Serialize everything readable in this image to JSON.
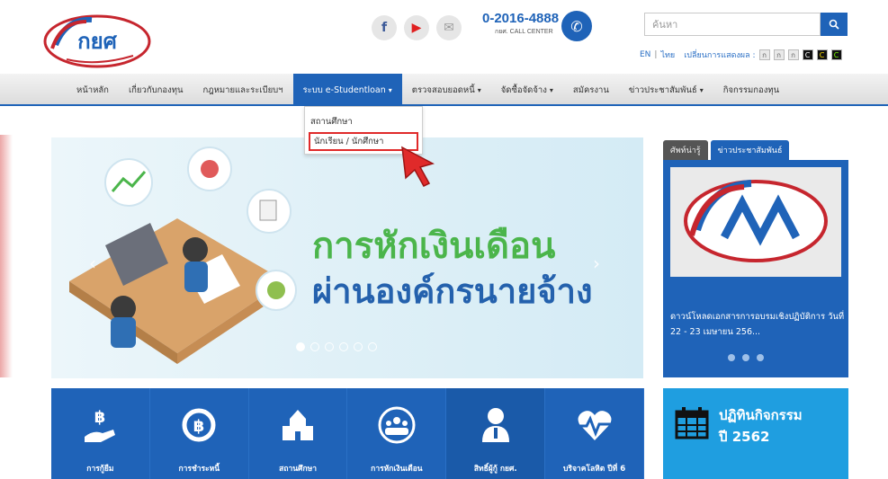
{
  "header": {
    "logo_text": "กยศ",
    "call": {
      "number": "0-2016-4888",
      "sub": "กยศ. CALL CENTER"
    },
    "search": {
      "placeholder": "ค้นหา"
    },
    "lang": {
      "en": "EN",
      "th": "ไทย"
    },
    "accessibility_label": "เปลี่ยนการแสดงผล :",
    "accessibility_options": [
      "ก",
      "ก",
      "ก",
      "C",
      "C",
      "C"
    ]
  },
  "nav": {
    "items": [
      "หน้าหลัก",
      "เกี่ยวกับกองทุน",
      "กฎหมายและระเบียบฯ",
      "ระบบ e-Studentloan",
      "ตรวจสอบยอดหนี้",
      "จัดซื้อจัดจ้าง",
      "สมัครงาน",
      "ข่าวประชาสัมพันธ์",
      "กิจกรรมกองทุน"
    ]
  },
  "dropdown": {
    "items": [
      "สถานศึกษา",
      "นักเรียน / นักศึกษา"
    ]
  },
  "banner": {
    "line1": "การหักเงินเดือน",
    "line2": "ผ่านองค์กรนายจ้าง"
  },
  "news": {
    "tab1": "ศัพท์น่ารู้",
    "tab2": "ข่าวประชาสัมพันธ์",
    "text": "ดาวน์โหลดเอกสารการอบรมเชิงปฏิบัติการ วันที่ 22 - 23 เมษายน 256..."
  },
  "tiles": [
    "การกู้ยืม",
    "การชำระหนี้",
    "สถานศึกษา",
    "การหักเงินเดือน",
    "สิทธิ์ผู้กู้ กยศ.",
    "บริจาคโลหิต ปีที่ 6"
  ],
  "activity": {
    "title": "ปฏิทินกิจกรรม",
    "year": "ปี 2562"
  },
  "colors": {
    "brand_blue": "#1f63b8",
    "banner_green": "#4bb54b",
    "highlight_red": "#e02a2a",
    "activity_blue": "#1f9ee0"
  }
}
